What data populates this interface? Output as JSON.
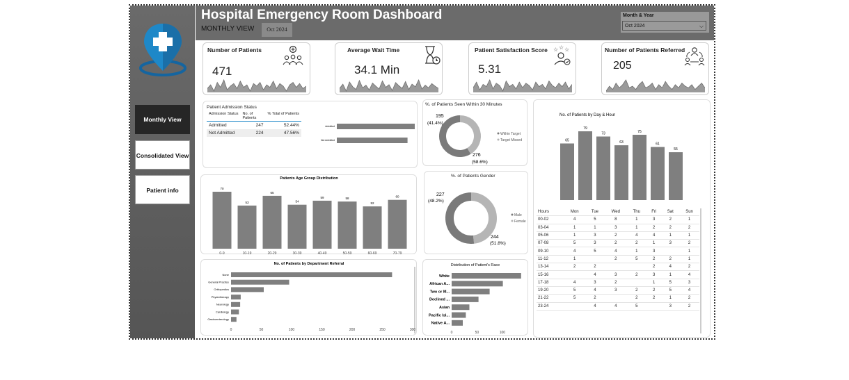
{
  "header": {
    "title": "Hospital Emergency Room Dashboard",
    "subtitle": "MONTHLY VIEW",
    "month_badge": "Oct 2024",
    "slicer_label": "Month & Year",
    "slicer_value": "Oct 2024"
  },
  "nav": {
    "monthly": "Monthly View",
    "consolidated": "Consolidated View",
    "patient_info": "Patient info"
  },
  "kpis": {
    "patients": {
      "title": "Number of Patients",
      "value": "471"
    },
    "wait": {
      "title": "Average Wait Time",
      "value": "34.1 Min"
    },
    "satisfaction": {
      "title": "Patient Satisfaction Score",
      "value": "5.31"
    },
    "referred": {
      "title": "Number of Patients Referred",
      "value": "205"
    }
  },
  "admission": {
    "title": "Patient Admission Status",
    "col1": "Admission Status",
    "col2": "No. of Patients",
    "col3": "% Total of Patients",
    "rows": [
      {
        "status": "Admitted",
        "count": "247",
        "pct": "52.44%",
        "bar_label": "Admitted"
      },
      {
        "status": "Not Admitted",
        "count": "224",
        "pct": "47.56%",
        "bar_label": "Not Admitted"
      }
    ]
  },
  "seen30": {
    "title": "%. of Patients Seen Within 30 Minutes",
    "top_label_count": "195",
    "top_label_pct": "(41.4%)",
    "bottom_label_count": "276",
    "bottom_label_pct": "(58.6%)",
    "legend": [
      "Within Target",
      "Target Missed"
    ]
  },
  "gender": {
    "title": "%. of Patients Gender",
    "top_label_count": "227",
    "top_label_pct": "(48.2%)",
    "bottom_label_count": "244",
    "bottom_label_pct": "(51.8%)",
    "legend": [
      "Male",
      "Female"
    ]
  },
  "day_title": "No. of Patients by Day & Hour",
  "hours_table": {
    "headers": [
      "Hours",
      "Mon",
      "Tue",
      "Wed",
      "Thu",
      "Fri",
      "Sat",
      "Sun"
    ],
    "rows": [
      [
        "00-02",
        "4",
        "5",
        "8",
        "1",
        "3",
        "2",
        "1"
      ],
      [
        "03-04",
        "1",
        "1",
        "3",
        "1",
        "2",
        "2",
        "2"
      ],
      [
        "05-06",
        "1",
        "3",
        "2",
        "4",
        "4",
        "1",
        "1"
      ],
      [
        "07-08",
        "5",
        "3",
        "2",
        "2",
        "1",
        "3",
        "2"
      ],
      [
        "09-10",
        "4",
        "5",
        "4",
        "1",
        "3",
        "",
        "1"
      ],
      [
        "11-12",
        "1",
        "",
        "2",
        "5",
        "2",
        "2",
        "1"
      ],
      [
        "13-14",
        "2",
        "2",
        "",
        "",
        "2",
        "4",
        "2"
      ],
      [
        "15-16",
        "",
        "4",
        "3",
        "2",
        "3",
        "1",
        "4"
      ],
      [
        "17-18",
        "4",
        "3",
        "2",
        "",
        "1",
        "5",
        "3"
      ],
      [
        "19-20",
        "5",
        "4",
        "3",
        "2",
        "2",
        "5",
        "4"
      ],
      [
        "21-22",
        "5",
        "2",
        "",
        "2",
        "2",
        "1",
        "2"
      ],
      [
        "23-24",
        "",
        "4",
        "4",
        "5",
        "",
        "3",
        "2"
      ]
    ]
  },
  "colors": {
    "bar": "#7f7f7f",
    "donut_dark": "#7a7a7a",
    "donut_light": "#b5b5b5",
    "header_bg": "#6b6b6b",
    "sidebar_bg": "#5f5f5f",
    "active_nav": "#262626",
    "logo_blue": "#1e88c8"
  },
  "icons": {
    "patients": "people-group-icon",
    "wait": "hourglass-clock-icon",
    "satisfaction": "person-stars-icon",
    "referred": "referral-network-icon",
    "logo": "hospital-location-pin-icon"
  },
  "chart_data": [
    {
      "type": "line",
      "x": [
        1,
        2,
        3,
        4,
        5,
        6,
        7,
        8,
        9,
        10,
        11,
        12,
        13,
        14,
        15,
        16,
        17,
        18,
        19,
        20,
        21,
        22,
        23,
        24,
        25,
        26,
        27,
        28,
        29,
        30,
        31
      ],
      "values": [
        8,
        11,
        6,
        13,
        9,
        15,
        7,
        10,
        12,
        8,
        14,
        9,
        11,
        6,
        12,
        10,
        13,
        7,
        11,
        9,
        14,
        8,
        12,
        10,
        6,
        11,
        13,
        9,
        12,
        8,
        10
      ]
    },
    {
      "type": "line",
      "x": [
        1,
        2,
        3,
        4,
        5,
        6,
        7,
        8,
        9,
        10,
        11,
        12,
        13,
        14,
        15,
        16,
        17,
        18,
        19,
        20,
        21,
        22,
        23,
        24,
        25,
        26,
        27,
        28,
        29,
        30,
        31
      ],
      "values": [
        30,
        38,
        25,
        42,
        33,
        28,
        45,
        31,
        36,
        27,
        40,
        34,
        29,
        44,
        32,
        37,
        26,
        41,
        35,
        30,
        43,
        28,
        38,
        33,
        46,
        29,
        36,
        31,
        39,
        34,
        30
      ]
    },
    {
      "type": "line",
      "x": [
        1,
        2,
        3,
        4,
        5,
        6,
        7,
        8,
        9,
        10,
        11,
        12,
        13,
        14,
        15,
        16,
        17,
        18,
        19,
        20,
        21,
        22,
        23,
        24,
        25,
        26,
        27,
        28,
        29,
        30,
        31
      ],
      "values": [
        5.1,
        5.6,
        4.9,
        5.4,
        5.2,
        5.8,
        5.0,
        5.5,
        5.3,
        4.8,
        5.7,
        5.2,
        5.4,
        5.0,
        5.6,
        5.1,
        5.5,
        5.3,
        4.9,
        5.6,
        5.2,
        5.4,
        5.0,
        5.7,
        5.3,
        5.1,
        5.5,
        5.2,
        5.6,
        5.0,
        5.4
      ]
    },
    {
      "type": "line",
      "x": [
        1,
        2,
        3,
        4,
        5,
        6,
        7,
        8,
        9,
        10,
        11,
        12,
        13,
        14,
        15,
        16,
        17,
        18,
        19,
        20,
        21,
        22,
        23,
        24,
        25,
        26,
        27,
        28,
        29,
        30,
        31
      ],
      "values": [
        4,
        7,
        5,
        9,
        6,
        8,
        11,
        6,
        7,
        5,
        8,
        10,
        6,
        7,
        9,
        5,
        8,
        6,
        10,
        7,
        5,
        8,
        6,
        9,
        7,
        6,
        8,
        5,
        7,
        9,
        6
      ]
    },
    {
      "type": "bar",
      "orientation": "horizontal",
      "categories": [
        "Admitted",
        "Not Admitted"
      ],
      "values": [
        247,
        224
      ],
      "xlim": [
        0,
        247
      ]
    },
    {
      "type": "pie",
      "title": "%. of Patients Seen Within 30 Minutes",
      "categories": [
        "Within Target",
        "Target Missed"
      ],
      "values": [
        195,
        276
      ],
      "percent": [
        41.4,
        58.6
      ]
    },
    {
      "type": "bar",
      "title": "Patients Age Group Distribution",
      "categories": [
        "0-9",
        "10-19",
        "20-29",
        "30-39",
        "40-49",
        "50-59",
        "60-69",
        "70-79"
      ],
      "values": [
        70,
        53,
        65,
        54,
        59,
        58,
        52,
        60
      ],
      "ylim": [
        0,
        70
      ]
    },
    {
      "type": "pie",
      "title": "%. of Patients Gender",
      "categories": [
        "Male",
        "Female"
      ],
      "values": [
        227,
        244
      ],
      "percent": [
        48.2,
        51.8
      ]
    },
    {
      "type": "bar",
      "title": "No. of Patients by Day & Hour",
      "categories": [
        "Mon",
        "Tue",
        "Wed",
        "Thu",
        "Fri",
        "Sat",
        "Sun"
      ],
      "values": [
        65,
        79,
        73,
        63,
        75,
        61,
        55
      ],
      "ylim": [
        0,
        79
      ]
    },
    {
      "type": "bar",
      "orientation": "horizontal",
      "title": "No. of Patients by Department Referral",
      "categories": [
        "None",
        "General Practice",
        "Orthopedics",
        "Physiotherapy",
        "Neurology",
        "Cardiology",
        "Gastroenterology"
      ],
      "values": [
        266,
        96,
        54,
        16,
        15,
        13,
        9
      ],
      "xlim": [
        0,
        300
      ],
      "xticks": [
        "0",
        "50",
        "100",
        "150",
        "200",
        "250",
        "300"
      ]
    },
    {
      "type": "bar",
      "orientation": "horizontal",
      "title": "Distribution of Patient's Race",
      "categories": [
        "White",
        "African A...",
        "Two or M...",
        "Declined ...",
        "Asian",
        "Pacific Isl...",
        "Native A..."
      ],
      "values": [
        137,
        101,
        75,
        53,
        35,
        28,
        22
      ],
      "xlim": [
        0,
        140
      ],
      "xticks": [
        "0",
        "50",
        "100"
      ]
    }
  ]
}
